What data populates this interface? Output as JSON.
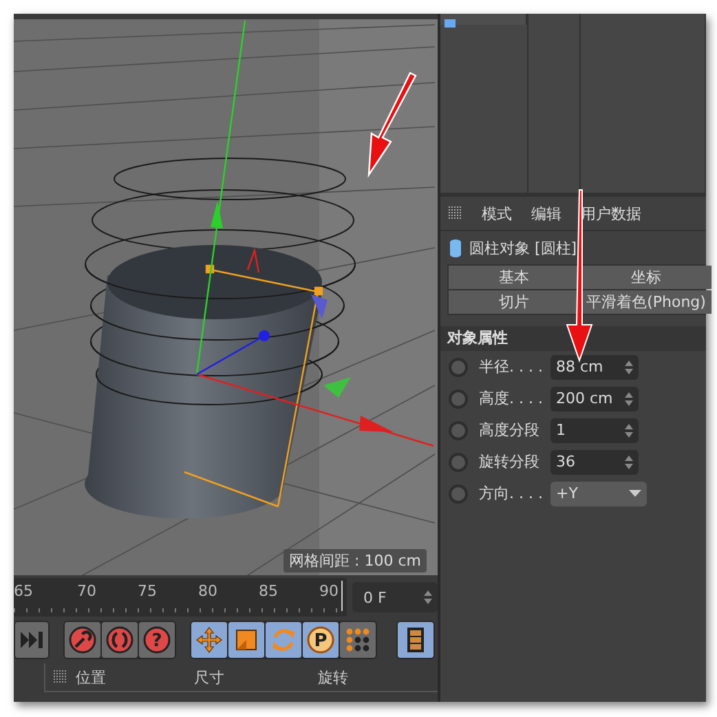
{
  "viewport": {
    "grid_spacing": "网格间距 : 100 cm"
  },
  "timeline": {
    "ticks": [
      "65",
      "70",
      "75",
      "80",
      "85",
      "90"
    ],
    "frame_field": {
      "value": "0 F"
    }
  },
  "toolbar": {
    "groups": [
      [
        {
          "kind": "skip-end",
          "on": false
        }
      ],
      [
        {
          "kind": "key-record",
          "on": false
        },
        {
          "kind": "auto-key",
          "on": false
        },
        {
          "kind": "help",
          "on": false,
          "label": "?"
        }
      ],
      [
        {
          "kind": "move",
          "on": true
        },
        {
          "kind": "scale",
          "on": true
        },
        {
          "kind": "rotate",
          "on": true
        },
        {
          "kind": "parameter",
          "on": true,
          "label": "P"
        },
        {
          "kind": "dots",
          "on": false
        }
      ],
      [
        {
          "kind": "film",
          "on": true
        }
      ]
    ]
  },
  "coordinates": {
    "columns": [
      "位置",
      "尺寸",
      "旋转"
    ]
  },
  "attributes": {
    "menu": [
      "模式",
      "编辑",
      "用户数据"
    ],
    "object_title": "圆柱对象 [圆柱]",
    "tabs": [
      "基本",
      "坐标",
      "切片",
      "平滑着色(Phong)"
    ],
    "section": "对象属性",
    "params": [
      {
        "label": "半径. . . .",
        "value": "88 cm",
        "kind": "number",
        "animated": false
      },
      {
        "label": "高度. . . .",
        "value": "200 cm",
        "kind": "number",
        "animated": false
      },
      {
        "label": "高度分段",
        "value": "1",
        "kind": "number",
        "animated": false
      },
      {
        "label": "旋转分段",
        "value": "36",
        "kind": "number",
        "animated": false
      },
      {
        "label": "方向. . . .",
        "value": "+Y",
        "kind": "dropdown",
        "animated": false
      }
    ]
  }
}
